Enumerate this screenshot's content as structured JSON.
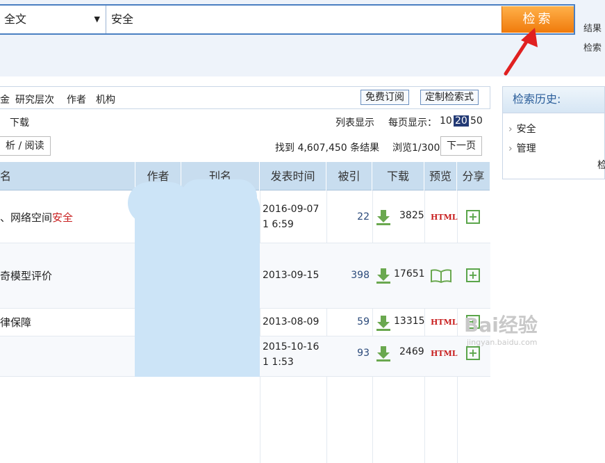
{
  "search": {
    "scope": "全文",
    "query": "安全",
    "button": "检索"
  },
  "top_right": {
    "result_link": "结果",
    "search_link": "检索"
  },
  "filter_bar": {
    "items": [
      "金",
      "研究层次",
      "作者",
      "机构"
    ],
    "subscribe": "免费订阅",
    "custom_search": "定制检索式"
  },
  "toolbar": {
    "download": "下载",
    "list_view": "列表显示",
    "per_page_label": "每页显示：",
    "per_page_options": [
      "10",
      "20",
      "50"
    ],
    "per_page_selected": "20",
    "analyze_read": "析 / 阅读",
    "found_text": "找到 4,607,450 条结果",
    "browse_text": "浏览1/300",
    "next_page": "下一页"
  },
  "table": {
    "headers": [
      "名",
      "作者",
      "刊名",
      "发表时间",
      "被引",
      "下载",
      "预览",
      "分享"
    ],
    "rows": [
      {
        "title_prefix": "、网络空间",
        "title_highlight": "安全",
        "date": "2016-09-07 1 6:59",
        "cited": "22",
        "downloads": "3825",
        "preview": "HTML"
      },
      {
        "title_prefix": "奇模型评价",
        "title_highlight": "",
        "date": "2013-09-15",
        "cited": "398",
        "downloads": "17651",
        "preview": "book"
      },
      {
        "title_prefix": "律保障",
        "title_highlight": "",
        "date": "2013-08-09",
        "cited": "59",
        "downloads": "13315",
        "preview": "HTML"
      },
      {
        "title_prefix": "",
        "title_highlight": "",
        "date": "2015-10-16 1 1:53",
        "cited": "93",
        "downloads": "2469",
        "preview": "HTML"
      }
    ]
  },
  "history": {
    "title": "检索历史:",
    "items": [
      "安全",
      "管理"
    ],
    "more": "检"
  },
  "watermark": {
    "brand": "Bai经验",
    "url": "jingyan.baidu.com"
  },
  "colors": {
    "search_button": "#f28a1a",
    "highlight": "#c81e1e",
    "accent": "#2a5d9a",
    "arrow": "#e02020"
  }
}
